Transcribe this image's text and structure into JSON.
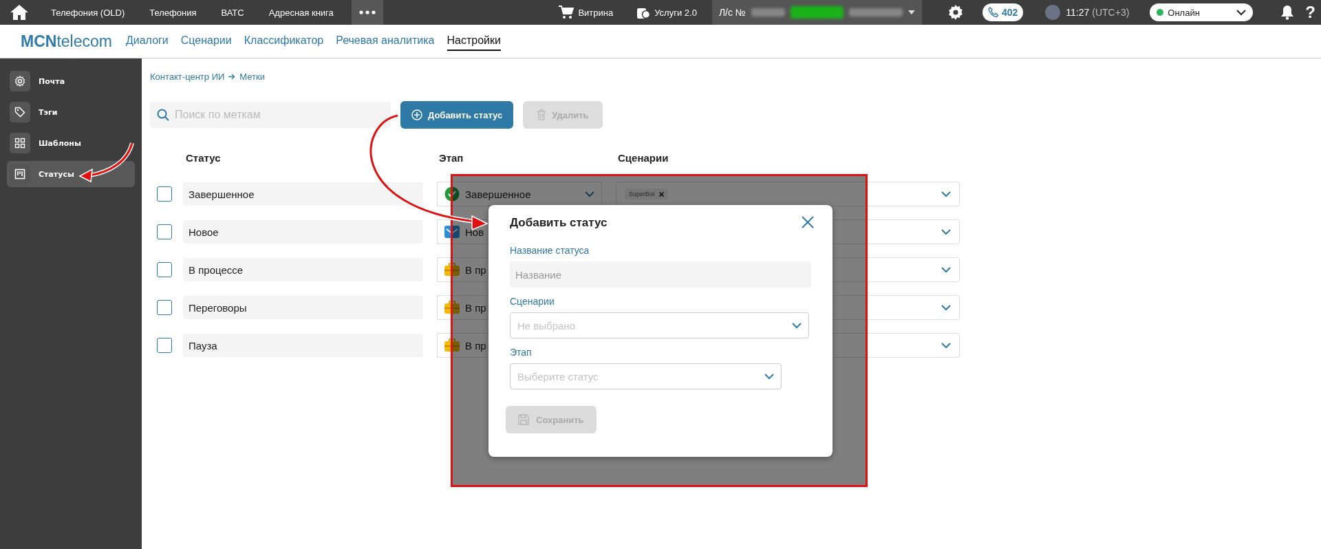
{
  "top_bar": {
    "menu": [
      {
        "label": "Телефония (OLD)"
      },
      {
        "label": "Телефония"
      },
      {
        "label": "ВАТС"
      },
      {
        "label": "Адресная книга"
      }
    ],
    "shop": "Витрина",
    "services": "Услуги 2.0",
    "account_label": "Л/с №",
    "calls": "402",
    "time": "11:27",
    "timezone": "(UTC+3)",
    "presence": "Онлайн",
    "help": "?"
  },
  "nav": {
    "logo": "**MCN**telecom",
    "tabs": [
      {
        "label": "Диалоги",
        "selected": false
      },
      {
        "label": "Сценарии",
        "selected": false
      },
      {
        "label": "Классификатор",
        "selected": false
      },
      {
        "label": "Речевая аналитика",
        "selected": false
      },
      {
        "label": "Настройки",
        "selected": true
      }
    ]
  },
  "sidebar": {
    "items": [
      {
        "label": "Почта",
        "kind": "gear",
        "selected": false
      },
      {
        "label": "Тэги",
        "kind": "tag",
        "selected": false
      },
      {
        "label": "Шаблоны",
        "kind": "grid",
        "selected": false
      },
      {
        "label": "Статусы",
        "kind": "board",
        "selected": true
      }
    ]
  },
  "breadcrumb": [
    "Контакт-центр ИИ",
    "Метки"
  ],
  "search": {
    "placeholder": "Поиск по меткам"
  },
  "buttons": {
    "add": "Добавить статус",
    "delete": "Удалить"
  },
  "table": {
    "columns": [
      "Статус",
      "Этап",
      "Сценарии"
    ],
    "rows": [
      {
        "checked": false,
        "name": "Завершенное",
        "stage": "Завершенное",
        "kind": "done",
        "scenarios": [
          "SuperBot"
        ]
      },
      {
        "checked": false,
        "name": "Новое",
        "stage": "Нов",
        "kind": "new",
        "scenarios": []
      },
      {
        "checked": false,
        "name": "В процессе",
        "stage": "В пр",
        "kind": "progress",
        "scenarios": []
      },
      {
        "checked": false,
        "name": "Переговоры",
        "stage": "В пр",
        "kind": "progress",
        "scenarios": []
      },
      {
        "checked": false,
        "name": "Пауза",
        "stage": "В пр",
        "kind": "progress",
        "scenarios": []
      }
    ]
  },
  "dialog": {
    "title": "Добавить статус",
    "name_label": "Название статуса",
    "name_placeholder": "Название",
    "scenarios_label": "Сценарии",
    "scenarios_placeholder": "Не выбрано",
    "stage_label": "Этап",
    "stage_placeholder": "Выберите статус",
    "save": "Сохранить",
    "save_disabled": true
  }
}
